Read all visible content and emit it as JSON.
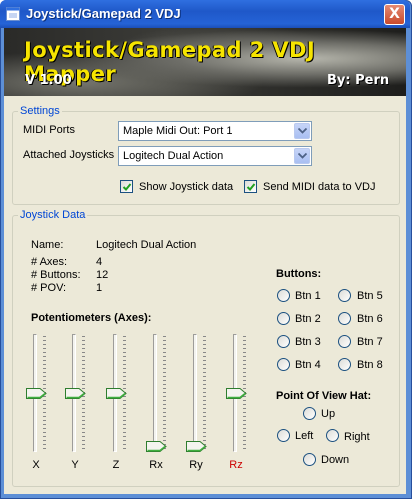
{
  "window": {
    "title": "Joystick/Gamepad 2 VDJ",
    "close_label": "X"
  },
  "banner": {
    "title": "Joystick/Gamepad 2 VDJ Mapper",
    "version": "V 1.00",
    "author": "By: Pern"
  },
  "settings": {
    "legend": "Settings",
    "midi_ports_label": "MIDI Ports",
    "midi_ports_value": "Maple Midi Out: Port 1",
    "joysticks_label": "Attached Joysticks",
    "joysticks_value": "Logitech Dual Action",
    "show_joystick": {
      "label": "Show Joystick data",
      "checked": true
    },
    "send_midi": {
      "label": "Send MIDI data to VDJ",
      "checked": true
    }
  },
  "joystick_data": {
    "legend": "Joystick Data",
    "name_label": "Name:",
    "name_value": "Logitech Dual Action",
    "axes_label": "# Axes:",
    "axes_value": "4",
    "buttons_label": "# Buttons:",
    "buttons_value": "12",
    "pov_label": "#  POV:",
    "pov_value": "1",
    "potentiometers_title": "Potentiometers (Axes):",
    "axes": [
      {
        "name": "X",
        "level": 0.5,
        "color": "#000000"
      },
      {
        "name": "Y",
        "level": 0.5,
        "color": "#000000"
      },
      {
        "name": "Z",
        "level": 0.5,
        "color": "#000000"
      },
      {
        "name": "Rx",
        "level": 0.0,
        "color": "#000000"
      },
      {
        "name": "Ry",
        "level": 0.0,
        "color": "#000000"
      },
      {
        "name": "Rz",
        "level": 0.5,
        "color": "#cc0000"
      }
    ],
    "buttons_title": "Buttons:",
    "buttons": [
      "Btn 1",
      "Btn 5",
      "Btn 2",
      "Btn 6",
      "Btn 3",
      "Btn 7",
      "Btn 4",
      "Btn 8"
    ],
    "pov_title": "Point Of View Hat:",
    "pov": {
      "up": "Up",
      "left": "Left",
      "right": "Right",
      "down": "Down"
    }
  }
}
